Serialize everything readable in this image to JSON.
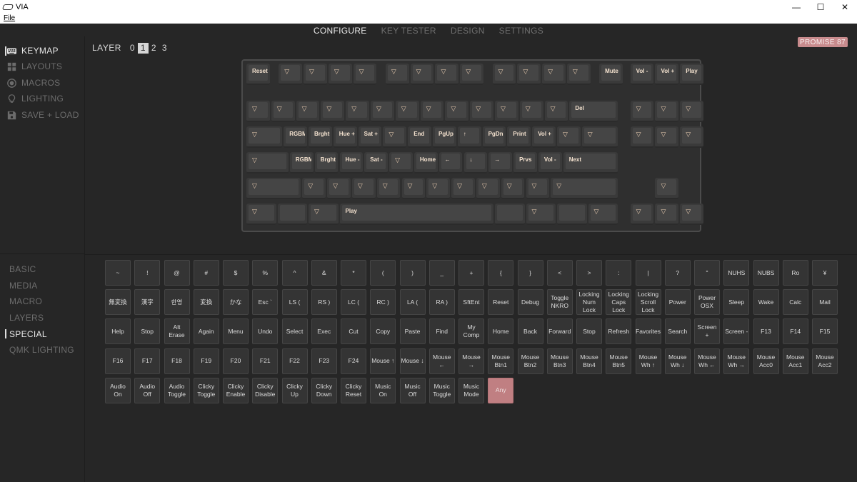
{
  "app": {
    "title": "VIA",
    "menu_file": "File"
  },
  "window_controls": {
    "minimize": "—",
    "maximize": "☐",
    "close": "✕"
  },
  "top_tabs": [
    {
      "label": "CONFIGURE",
      "active": true
    },
    {
      "label": "KEY TESTER",
      "active": false
    },
    {
      "label": "DESIGN",
      "active": false
    },
    {
      "label": "SETTINGS",
      "active": false
    }
  ],
  "sidebar": {
    "items": [
      {
        "label": "KEYMAP",
        "icon": "keyboard-icon",
        "active": true
      },
      {
        "label": "LAYOUTS",
        "icon": "layout-grid-icon",
        "active": false
      },
      {
        "label": "MACROS",
        "icon": "record-icon",
        "active": false
      },
      {
        "label": "LIGHTING",
        "icon": "lightbulb-icon",
        "active": false
      },
      {
        "label": "SAVE + LOAD",
        "icon": "floppy-disk-icon",
        "active": false
      }
    ],
    "categories": [
      {
        "label": "BASIC",
        "active": false
      },
      {
        "label": "MEDIA",
        "active": false
      },
      {
        "label": "MACRO",
        "active": false
      },
      {
        "label": "LAYERS",
        "active": false
      },
      {
        "label": "SPECIAL",
        "active": true
      },
      {
        "label": "QMK LIGHTING",
        "active": false
      }
    ]
  },
  "layers": {
    "label": "LAYER",
    "items": [
      "0",
      "1",
      "2",
      "3"
    ],
    "selected": "1"
  },
  "keyboard_name": "PROMISE 87",
  "picker_keys": [
    "~",
    "!",
    "@",
    "#",
    "$",
    "%",
    "^",
    "&",
    "*",
    "(",
    ")",
    "_",
    "+",
    "{",
    "}",
    "<",
    ">",
    ":",
    "|",
    "?",
    "\"",
    "NUHS",
    "NUBS",
    "Ro",
    "¥",
    "無変換",
    "漢字",
    "한영",
    "変換",
    "かな",
    "Esc `",
    "LS (",
    "RS )",
    "LC (",
    "RC )",
    "LA (",
    "RA )",
    "SftEnt",
    "Reset",
    "Debug",
    "Toggle\nNKRO",
    "Locking\nNum\nLock",
    "Locking\nCaps\nLock",
    "Locking\nScroll\nLock",
    "Power",
    "Power\nOSX",
    "Sleep",
    "Wake",
    "Calc",
    "Mail",
    "Help",
    "Stop",
    "Alt\nErase",
    "Again",
    "Menu",
    "Undo",
    "Select",
    "Exec",
    "Cut",
    "Copy",
    "Paste",
    "Find",
    "My\nComp",
    "Home",
    "Back",
    "Forward",
    "Stop",
    "Refresh",
    "Favorites",
    "Search",
    "Screen +",
    "Screen -",
    "F13",
    "F14",
    "F15",
    "F16",
    "F17",
    "F18",
    "F19",
    "F20",
    "F21",
    "F22",
    "F23",
    "F24",
    "Mouse ↑",
    "Mouse ↓",
    "Mouse\n←",
    "Mouse\n→",
    "Mouse\nBtn1",
    "Mouse\nBtn2",
    "Mouse\nBtn3",
    "Mouse\nBtn4",
    "Mouse\nBtn5",
    "Mouse\nWh ↑",
    "Mouse\nWh ↓",
    "Mouse\nWh ←",
    "Mouse\nWh →",
    "Mouse\nAcc0",
    "Mouse\nAcc1",
    "Mouse\nAcc2",
    "Audio\nOn",
    "Audio\nOff",
    "Audio\nToggle",
    "Clicky\nToggle",
    "Clicky\nEnable",
    "Clicky\nDisable",
    "Clicky\nUp",
    "Clicky\nDown",
    "Clicky\nReset",
    "Music\nOn",
    "Music\nOff",
    "Music\nToggle",
    "Music\nMode",
    "Any"
  ],
  "keyboard_keys": {
    "row0": [
      "Reset",
      "▽",
      "▽",
      "▽",
      "▽",
      "▽",
      "▽",
      "▽",
      "▽",
      "▽",
      "▽",
      "▽",
      "▽",
      "Mute",
      "Vol -",
      "Vol +",
      "Play"
    ],
    "row1": [
      "▽",
      "▽",
      "▽",
      "▽",
      "▽",
      "▽",
      "▽",
      "▽",
      "▽",
      "▽",
      "▽",
      "▽",
      "▽",
      "Del",
      "▽",
      "▽",
      "▽"
    ],
    "row2": [
      "▽",
      "RGBMd+",
      "Brght+",
      "Hue +",
      "Sat +",
      "▽",
      "End",
      "PgUp",
      "↑",
      "PgDn",
      "Print",
      "Vol +",
      "▽",
      "▽",
      "▽",
      "▽",
      "▽"
    ],
    "row3": [
      "▽",
      "RGBMd-",
      "Brght-",
      "Hue -",
      "Sat -",
      "▽",
      "Home",
      "←",
      "↓",
      "→",
      "Prvs",
      "Vol -",
      "Next"
    ],
    "row4": [
      "▽",
      "▽",
      "▽",
      "▽",
      "▽",
      "▽",
      "▽",
      "▽",
      "▽",
      "▽",
      "▽",
      "▽",
      "▽"
    ],
    "row5": [
      "▽",
      "",
      "▽",
      "Play",
      "",
      "▽",
      "",
      "▽",
      "▽",
      "▽",
      "▽"
    ]
  }
}
